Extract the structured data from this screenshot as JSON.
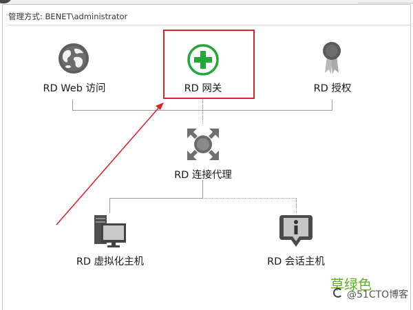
{
  "header": {
    "management_label": "管理方式: BENET\\administrator"
  },
  "nodes": {
    "rd_web": {
      "label": "RD Web 访问",
      "icon": "globe-icon"
    },
    "rd_gateway": {
      "label": "RD 网关",
      "icon": "plus-circle-icon",
      "highlighted": true
    },
    "rd_license": {
      "label": "RD 授权",
      "icon": "award-ribbon-icon"
    },
    "rd_broker": {
      "label": "RD 连接代理",
      "icon": "broker-arrows-icon"
    },
    "rd_virtualization": {
      "label": "RD 虚拟化主机",
      "icon": "server-monitor-icon"
    },
    "rd_session": {
      "label": "RD 会话主机",
      "icon": "info-bubble-icon"
    }
  },
  "annotation": {
    "highlight_color": "#d6262b"
  },
  "watermark": {
    "title": "草绿色",
    "site": "@51CTO博客"
  },
  "colors": {
    "gateway_green": "#22a83a",
    "connector": "#9a9a9a",
    "watermark_green": "#58b51d"
  }
}
